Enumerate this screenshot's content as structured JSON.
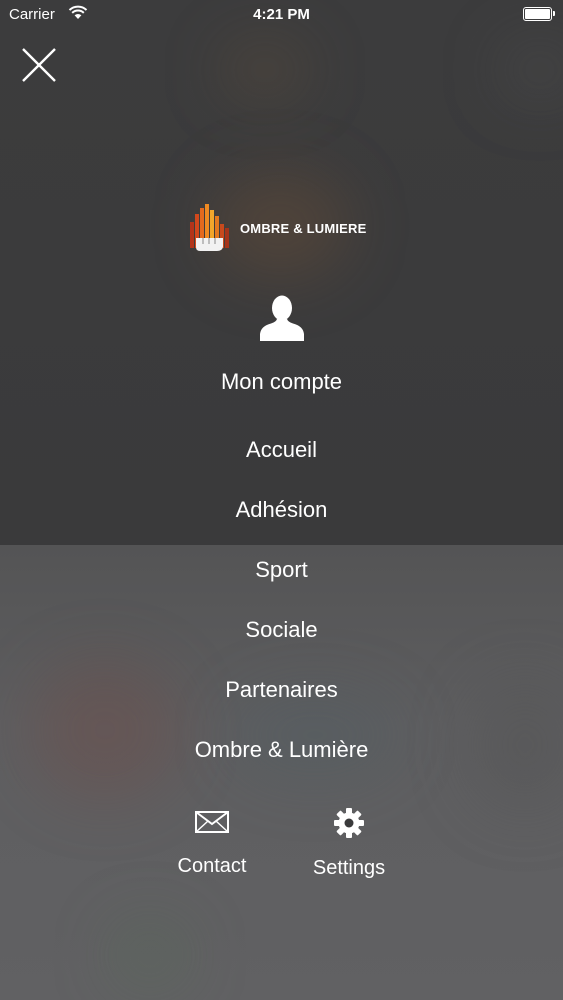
{
  "status_bar": {
    "carrier": "Carrier",
    "time": "4:21 PM"
  },
  "brand": {
    "name": "OMBRE & LUMIERE"
  },
  "account": {
    "label": "Mon compte"
  },
  "menu": {
    "items": [
      {
        "label": "Accueil"
      },
      {
        "label": "Adhésion"
      },
      {
        "label": "Sport"
      },
      {
        "label": "Sociale"
      },
      {
        "label": "Partenaires"
      },
      {
        "label": "Ombre & Lumière"
      }
    ]
  },
  "footer": {
    "contact": {
      "label": "Contact",
      "icon": "envelope-icon"
    },
    "settings": {
      "label": "Settings",
      "icon": "gear-icon"
    }
  },
  "colors": {
    "overlay": "#3a3a3b",
    "text": "#ffffff",
    "logo_orange": "#e0621b"
  }
}
